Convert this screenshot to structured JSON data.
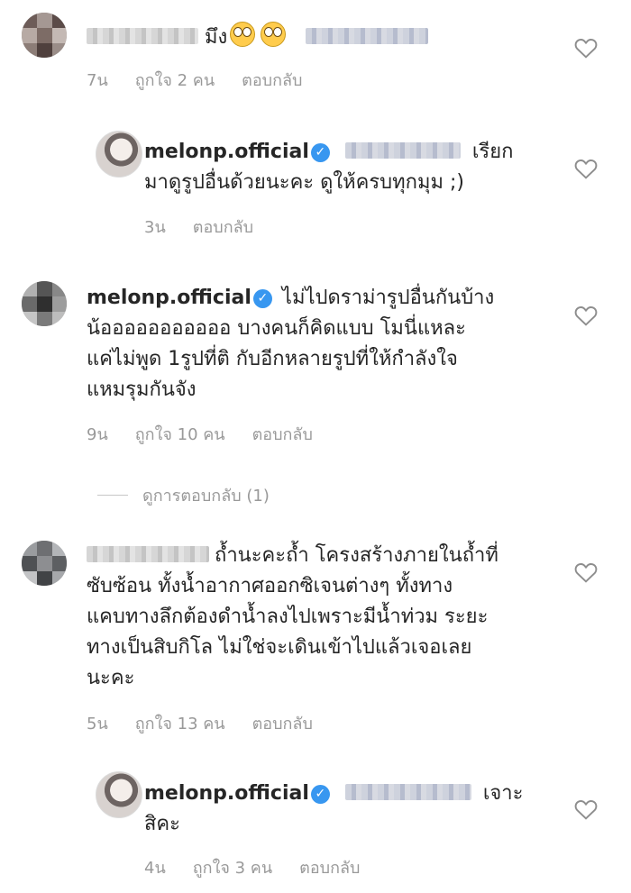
{
  "comments": [
    {
      "username": "",
      "text_lines": [
        "มึง"
      ],
      "time": "7น",
      "likes": "ถูกใจ 2 คน",
      "reply": "ตอบกลับ"
    },
    {
      "username": "melonp.official",
      "text_lines": [
        "เรียก",
        "มาดูรูปอื่นด้วยนะคะ ดูให้ครบทุกมุม ;)"
      ],
      "time": "3น",
      "likes": "",
      "reply": "ตอบกลับ"
    },
    {
      "username": "melonp.official",
      "text_lines": [
        "ไม่ไปดราม่ารูปอื่นกันบ้าง",
        "น้อออออออออออ บางคนก็คิดแบบ โมนี่แหละ",
        "แค่ไม่พูด 1รูปที่ติ กับอีกหลายรูปที่ให้กำลังใจ",
        "แหมรุมกันจัง"
      ],
      "time": "9น",
      "likes": "ถูกใจ 10 คน",
      "reply": "ตอบกลับ"
    },
    {
      "username": "",
      "text_lines": [
        "ถ้ำนะคะถ้ำ โครงสร้างภายในถ้ำที่",
        "ซับซ้อน ทั้งน้ำอากาศออกซิเจนต่างๆ ทั้งทาง",
        "แคบทางลึกต้องดำน้ำลงไปเพราะมีน้ำท่วม ระยะ",
        "ทางเป็นสิบกิโล ไม่ใช่จะเดินเข้าไปแล้วเจอเลย",
        "นะคะ"
      ],
      "time": "5น",
      "likes": "ถูกใจ 13 คน",
      "reply": "ตอบกลับ"
    },
    {
      "username": "melonp.official",
      "text_lines": [
        "เจาะ",
        "สิคะ"
      ],
      "time": "4น",
      "likes": "ถูกใจ 3 คน",
      "reply": "ตอบกลับ"
    }
  ],
  "view_replies": "ดูการตอบกลับ (1)",
  "colors": {
    "text": "#262626",
    "meta": "#999999",
    "verified": "#3897f0",
    "heart": "#8e8e8e"
  },
  "icons": {
    "verified": "verified-badge-icon",
    "like": "heart-outline-icon",
    "emoji": "face-with-rolling-eyes-icon"
  }
}
